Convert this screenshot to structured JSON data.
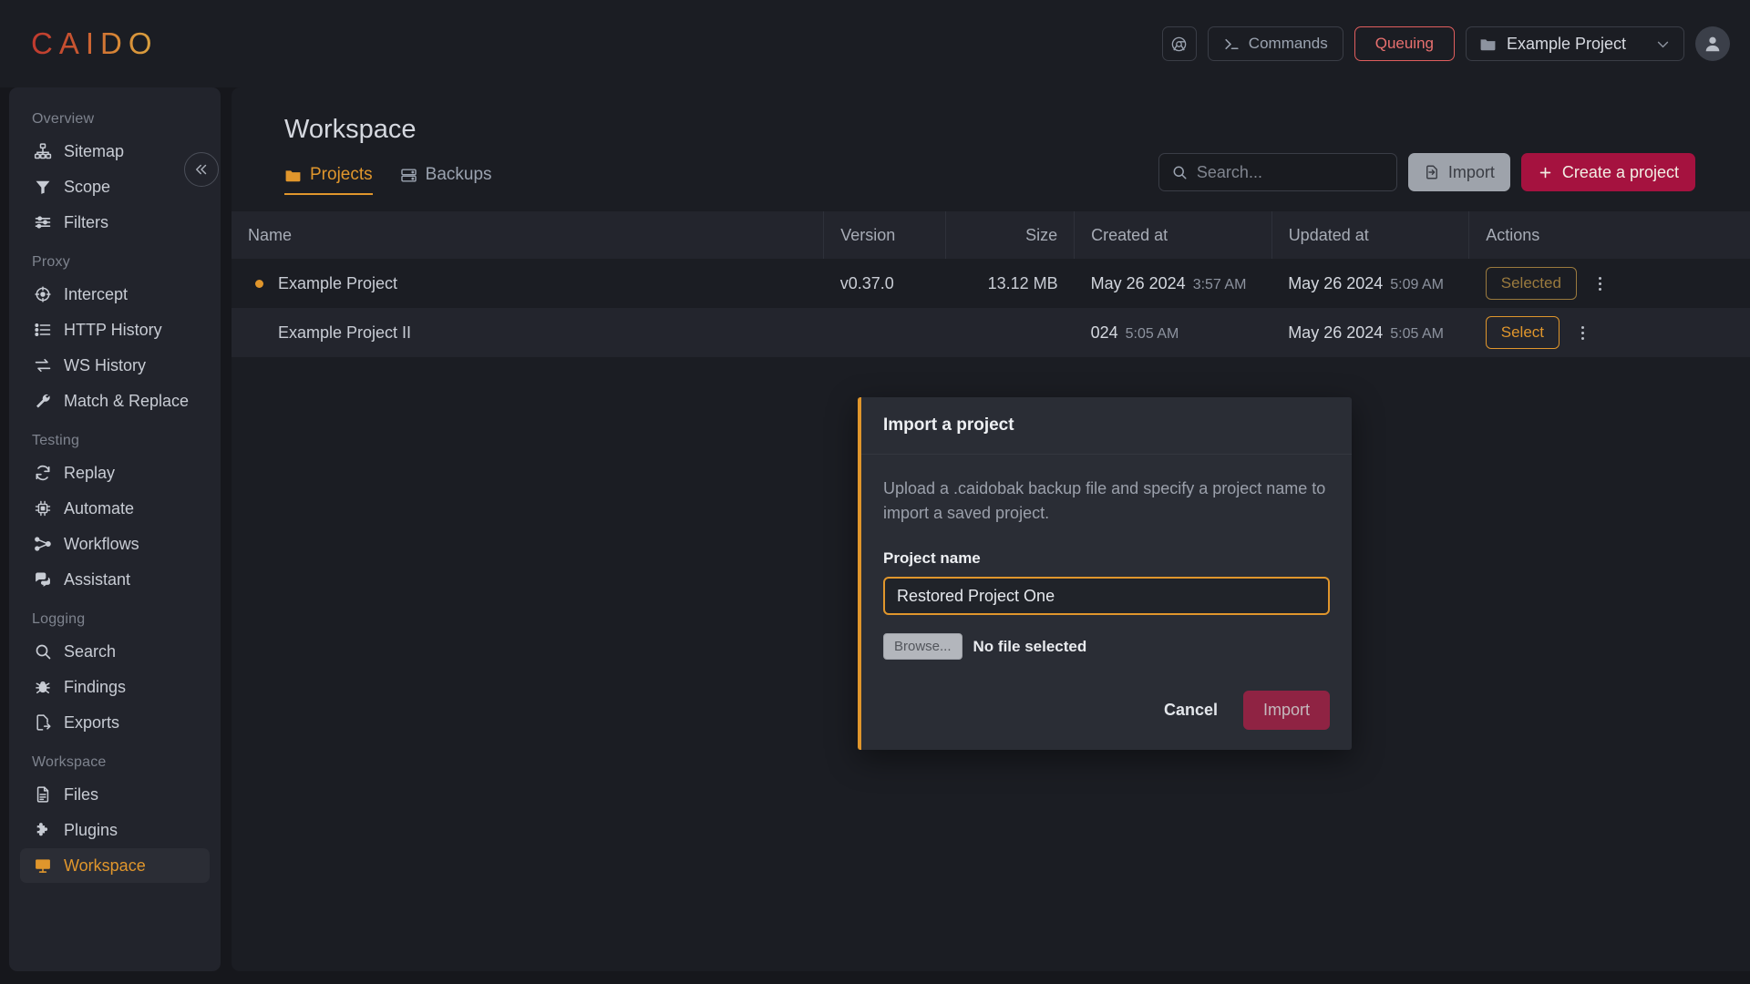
{
  "app": {
    "logo_text": "CAIDO"
  },
  "topbar": {
    "browser_icon": "chrome-icon",
    "commands_label": "Commands",
    "commands_icon": "terminal-prompt-icon",
    "queuing_label": "Queuing",
    "project_selector": {
      "icon": "folder-icon",
      "value": "Example Project",
      "chevron": "chevron-down-icon"
    },
    "avatar_icon": "user-avatar-icon"
  },
  "sidebar": {
    "collapse_icon": "chevrons-left-icon",
    "groups": [
      {
        "label": "Overview",
        "items": [
          {
            "label": "Sitemap",
            "icon": "sitemap-icon",
            "active": false
          },
          {
            "label": "Scope",
            "icon": "funnel-icon",
            "active": false
          },
          {
            "label": "Filters",
            "icon": "sliders-icon",
            "active": false
          }
        ]
      },
      {
        "label": "Proxy",
        "items": [
          {
            "label": "Intercept",
            "icon": "crosshair-icon",
            "active": false
          },
          {
            "label": "HTTP History",
            "icon": "list-icon",
            "active": false
          },
          {
            "label": "WS History",
            "icon": "exchange-arrows-icon",
            "active": false
          },
          {
            "label": "Match & Replace",
            "icon": "wrench-icon",
            "active": false
          }
        ]
      },
      {
        "label": "Testing",
        "items": [
          {
            "label": "Replay",
            "icon": "refresh-icon",
            "active": false
          },
          {
            "label": "Automate",
            "icon": "cpu-chip-icon",
            "active": false
          },
          {
            "label": "Workflows",
            "icon": "workflow-nodes-icon",
            "active": false
          },
          {
            "label": "Assistant",
            "icon": "chat-bubbles-icon",
            "active": false
          }
        ]
      },
      {
        "label": "Logging",
        "items": [
          {
            "label": "Search",
            "icon": "search-icon",
            "active": false
          },
          {
            "label": "Findings",
            "icon": "bug-icon",
            "active": false
          },
          {
            "label": "Exports",
            "icon": "file-export-icon",
            "active": false
          }
        ]
      },
      {
        "label": "Workspace",
        "items": [
          {
            "label": "Files",
            "icon": "file-icon",
            "active": false
          },
          {
            "label": "Plugins",
            "icon": "puzzle-piece-icon",
            "active": false
          },
          {
            "label": "Workspace",
            "icon": "monitor-icon",
            "active": true
          }
        ]
      }
    ]
  },
  "main": {
    "page_title": "Workspace",
    "tabs": [
      {
        "label": "Projects",
        "icon": "folder-icon",
        "active": true
      },
      {
        "label": "Backups",
        "icon": "server-icon",
        "active": false
      }
    ],
    "search": {
      "placeholder": "Search...",
      "value": "",
      "icon": "search-icon"
    },
    "import_button": {
      "label": "Import",
      "icon": "import-file-icon"
    },
    "create_button": {
      "label": "Create a project",
      "icon": "plus-icon"
    },
    "table": {
      "columns": [
        "Name",
        "Version",
        "Size",
        "Created at",
        "Updated at",
        "Actions"
      ],
      "rows": [
        {
          "name": "Example Project",
          "selected_dot": true,
          "version": "v0.37.0",
          "size": "13.12 MB",
          "created_date": "May 26 2024",
          "created_time": "3:57 AM",
          "updated_date": "May 26 2024",
          "updated_time": "5:09 AM",
          "action_label": "Selected",
          "action_state": "selected",
          "menu_icon": "kebab-menu-icon"
        },
        {
          "name": "Example Project II",
          "selected_dot": false,
          "version": "",
          "size": "",
          "created_date": "",
          "created_time": "5:05 AM",
          "created_partial": "024",
          "updated_date": "May 26 2024",
          "updated_time": "5:05 AM",
          "action_label": "Select",
          "action_state": "selectable",
          "menu_icon": "kebab-menu-icon"
        }
      ]
    }
  },
  "modal": {
    "title": "Import a project",
    "description": "Upload a .caidobak backup file and specify a project name to import a saved project.",
    "field_label": "Project name",
    "project_name_value": "Restored Project One",
    "project_name_placeholder": "",
    "browse_label": "Browse...",
    "file_status": "No file selected",
    "cancel_label": "Cancel",
    "import_label": "Import"
  },
  "colors": {
    "accent_amber": "#e0962c",
    "accent_crimson": "#a5123f",
    "danger_red": "#e05e5e",
    "bg_app": "#16171c",
    "bg_panel": "#1b1d23",
    "bg_sidebar": "#22242c",
    "bg_modal": "#2a2d35"
  }
}
